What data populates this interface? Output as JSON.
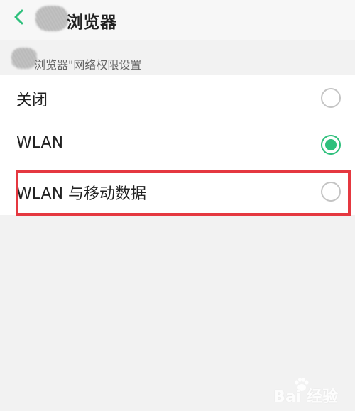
{
  "header": {
    "title": "浏览器"
  },
  "section": {
    "title": "浏览器\"网络权限设置"
  },
  "options": [
    {
      "label": "关闭",
      "selected": false
    },
    {
      "label": "WLAN",
      "selected": true
    },
    {
      "label": "WLAN 与移动数据",
      "selected": false
    }
  ],
  "colors": {
    "accent": "#2ec07c",
    "highlight": "#e53840"
  },
  "watermark": {
    "text": "Bai 经验"
  }
}
